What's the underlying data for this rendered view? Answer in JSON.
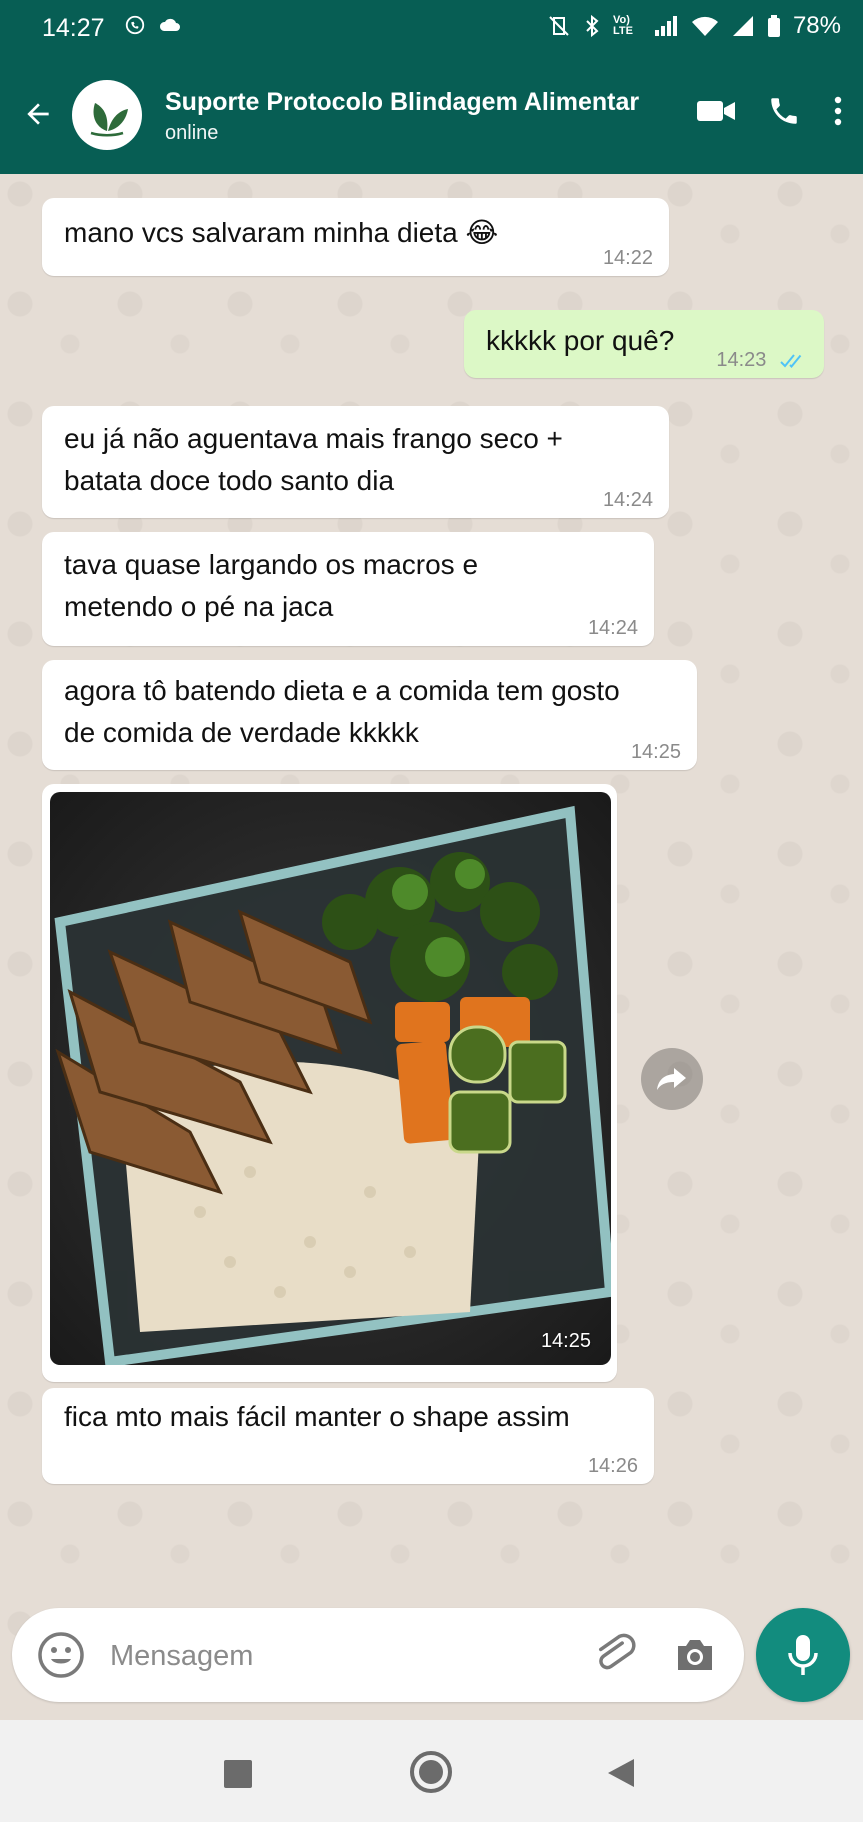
{
  "status_bar": {
    "time": "14:27",
    "battery": "78%",
    "network_label": "Vo) LTE"
  },
  "header": {
    "contact_name": "Suporte Protocolo Blindagem Alimentar",
    "contact_status": "online",
    "icons": [
      "back-arrow-icon",
      "leaf-logo-icon",
      "video-call-icon",
      "phone-icon",
      "more-vert-icon"
    ]
  },
  "messages": [
    {
      "direction": "in",
      "text": "mano vcs salvaram minha dieta 😂",
      "time": "14:22"
    },
    {
      "direction": "out",
      "text": "kkkkk por quê?",
      "time": "14:23",
      "status": "read"
    },
    {
      "direction": "in",
      "text": "eu já não aguentava mais frango seco + batata doce todo santo dia",
      "time": "14:24"
    },
    {
      "direction": "in",
      "text": "tava quase largando os macros e metendo o pé na jaca",
      "time": "14:24"
    },
    {
      "direction": "in",
      "text": "agora tô batendo dieta e a comida tem gosto de comida de verdade kkkkk",
      "time": "14:25"
    },
    {
      "direction": "in",
      "type": "image",
      "image_description_icon": "meal-prep-photo",
      "time": "14:25"
    },
    {
      "direction": "in",
      "text": "fica mto mais fácil manter o shape assim",
      "time": "14:26"
    }
  ],
  "composer": {
    "placeholder": "Mensagem",
    "icons": [
      "emoji-icon",
      "attach-icon",
      "camera-icon",
      "mic-icon"
    ]
  },
  "colors": {
    "header": "#075e54",
    "outgoing_bubble": "#dcf8c6",
    "mic_button": "#128c7e",
    "read_check": "#4fc3f7"
  }
}
